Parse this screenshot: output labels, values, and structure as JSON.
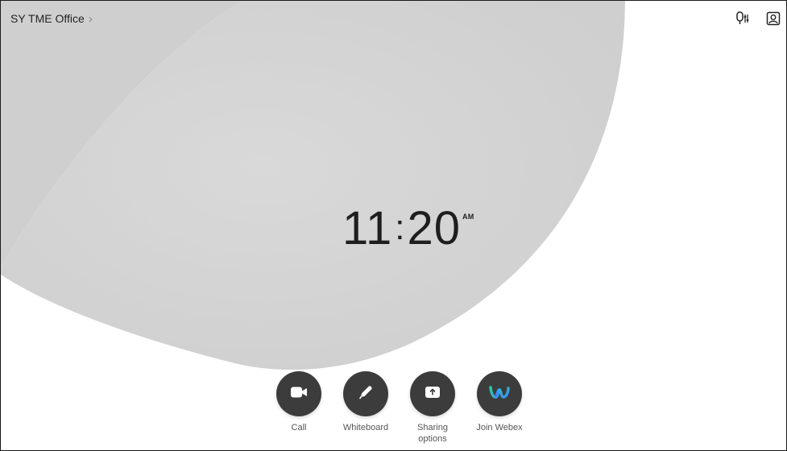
{
  "header": {
    "location": "SY TME Office",
    "location_chevron": "›",
    "icons": [
      "mic-settings-icon",
      "self-view-icon"
    ]
  },
  "clock": {
    "hours": "11",
    "separator": ":",
    "minutes": "20",
    "meridiem": "AM"
  },
  "dock": {
    "items": [
      {
        "label": "Call",
        "icon": "video-camera-icon"
      },
      {
        "label": "Whiteboard",
        "icon": "pencil-icon"
      },
      {
        "label": "Sharing options",
        "icon": "share-upload-icon"
      },
      {
        "label": "Join Webex",
        "icon": "webex-logo-icon"
      }
    ]
  },
  "colors": {
    "button_bg": "#3c3c3c",
    "shape_gray": "#d7d7d7",
    "background": "#ffffff",
    "webex_blue": "#3a8ef6",
    "webex_green": "#2ad0a6"
  }
}
